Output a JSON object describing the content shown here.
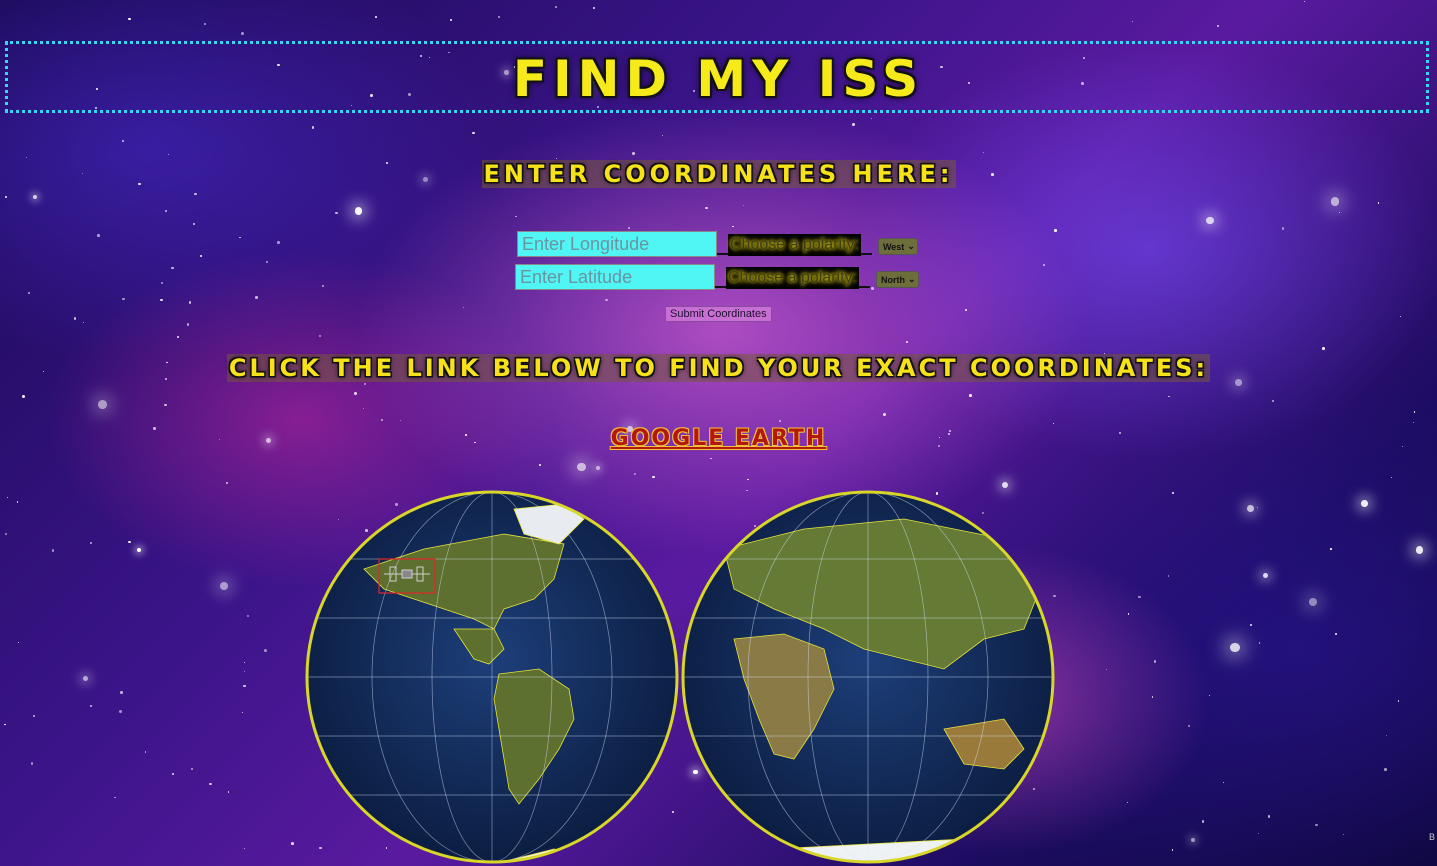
{
  "header": {
    "title": "Find My ISS"
  },
  "coordinates_form": {
    "heading": "Enter Coordinates Here:",
    "longitude": {
      "placeholder": "Enter Longitude",
      "value": ""
    },
    "latitude": {
      "placeholder": "Enter Latitude",
      "value": ""
    },
    "longitude_polarity": {
      "label": "Choose a polarity:",
      "selected": "West"
    },
    "latitude_polarity": {
      "label": "Choose a polarity:",
      "selected": "North"
    },
    "submit_label": "Submit Coordinates"
  },
  "help": {
    "heading": "Click the link below to find your exact coordinates:",
    "link_label": "Google Earth"
  },
  "map": {
    "globe_border_color": "#d8d628",
    "iss_marker_color": "#e0282a"
  },
  "corner_text": "B"
}
